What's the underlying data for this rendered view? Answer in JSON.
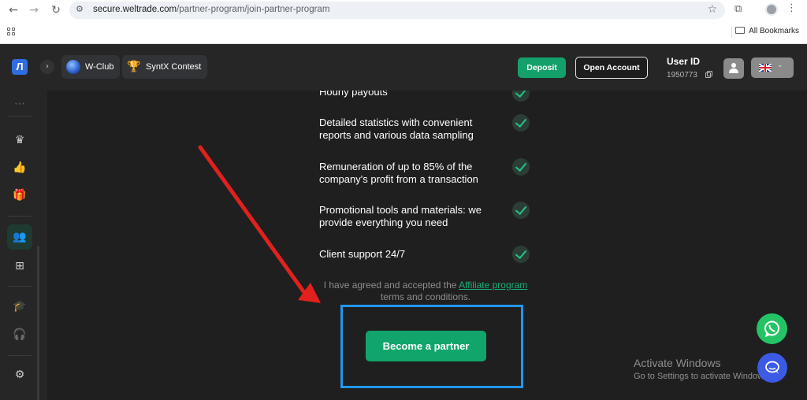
{
  "browser": {
    "url_host": "secure.weltrade.com",
    "url_path": "/partner-program/join-partner-program",
    "all_bookmarks": "All Bookmarks"
  },
  "topbar": {
    "wclub_label": "W-Club",
    "syntx_label": "SyntX Contest",
    "deposit_label": "Deposit",
    "open_account_label": "Open Account",
    "user_id_label": "User ID",
    "user_id_value": "1950773"
  },
  "benefits": [
    {
      "text": "Hourly payouts"
    },
    {
      "text": "Detailed statistics with convenient reports and various data sampling"
    },
    {
      "text": "Remuneration of up to 85% of the company's profit from a transaction"
    },
    {
      "text": "Promotional tools and materials: we provide everything you need"
    },
    {
      "text": "Client support 24/7"
    }
  ],
  "agreement": {
    "prefix": "I have agreed and accepted the",
    "link": "Affiliate program",
    "suffix": "terms and conditions."
  },
  "cta": {
    "become_partner_label": "Become a partner"
  },
  "watermark": {
    "title": "Activate Windows",
    "subtitle": "Go to Settings to activate Windows."
  },
  "colors": {
    "accent_green": "#11a56c",
    "highlight_blue": "#2196f3",
    "annotation_red": "#e0211d"
  }
}
